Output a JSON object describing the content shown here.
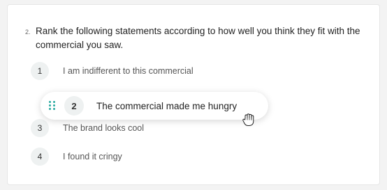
{
  "question": {
    "number": "2.",
    "text": "Rank the following statements according to how well you think they fit with the commercial you saw."
  },
  "items": [
    {
      "rank": "1",
      "label": "I am indifferent to this commercial"
    },
    {
      "rank": "3",
      "label": "The brand looks cool"
    },
    {
      "rank": "4",
      "label": "I found it cringy"
    }
  ],
  "dragging_item": {
    "rank": "2",
    "label": "The commercial made me hungry"
  },
  "colors": {
    "accent": "#27a9a0",
    "badge_bg": "#eef1f1"
  },
  "icons": {
    "drag_handle": "drag-handle-icon",
    "cursor": "grab-hand-cursor-icon"
  }
}
